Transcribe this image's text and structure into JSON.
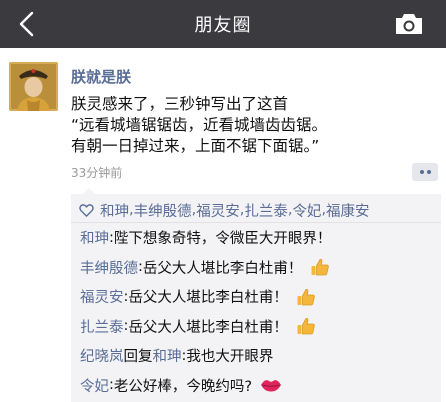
{
  "navbar": {
    "title": "朋友圈",
    "back_icon": "chevron-left-icon",
    "camera_icon": "camera-icon"
  },
  "post": {
    "author": "朕就是朕",
    "content_lines": [
      "朕灵感来了，三秒钟写出了这首",
      "“远看城墙锯锯齿，近看城墙齿齿锯。",
      "有朝一日掉过来，上面不锯下面锯。”"
    ],
    "timestamp": "33分钟前",
    "likes": [
      "和珅",
      "丰绅殷德",
      "福灵安",
      "扎兰泰",
      "令妃",
      "福康安"
    ],
    "like_separator": ",",
    "comments": [
      {
        "name": "和珅",
        "colon": ":",
        "text": "陛下想象奇特，令微臣大开眼界！"
      },
      {
        "name": "丰绅殷德",
        "colon": ":",
        "text": "岳父大人堪比李白杜甫！",
        "emoji": "thumbs-up-icon"
      },
      {
        "name": "福灵安",
        "colon": ":",
        "text": "岳父大人堪比李白杜甫！",
        "emoji": "thumbs-up-icon"
      },
      {
        "name": "扎兰泰",
        "colon": ":",
        "text": "岳父大人堪比李白杜甫！",
        "emoji": "thumbs-up-icon"
      },
      {
        "name": "纪晓岚",
        "reply_word": "回复",
        "reply_to": "和珅",
        "colon": ":",
        "text": "我也大开眼界"
      },
      {
        "name": "令妃",
        "colon": ":",
        "text": "老公好棒，今晚约吗?",
        "emoji": "kiss-lips-icon"
      }
    ]
  },
  "colors": {
    "navbar_bg": "#3b3b3f",
    "name_link": "#5a6d97",
    "comment_bg": "#f3f3f5",
    "thumb": "#f4b73b",
    "lips": "#e0245e"
  }
}
